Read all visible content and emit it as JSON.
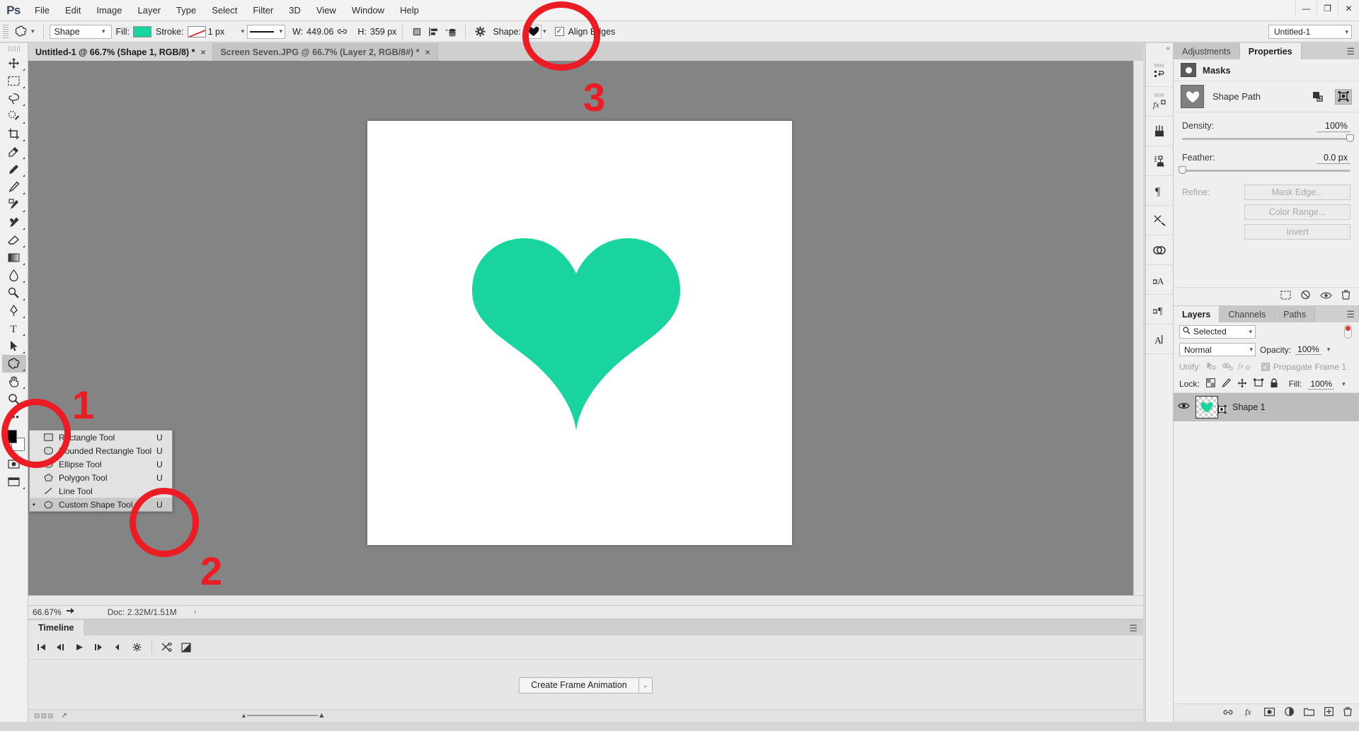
{
  "app": {
    "logo": "Ps",
    "doc_selector": "Untitled-1"
  },
  "menu": {
    "items": [
      "File",
      "Edit",
      "Image",
      "Layer",
      "Type",
      "Select",
      "Filter",
      "3D",
      "View",
      "Window",
      "Help"
    ]
  },
  "window_buttons": {
    "minimize": "—",
    "restore": "❐",
    "close": "✕"
  },
  "options_bar": {
    "tool_icon": "custom-shape-tool-icon",
    "mode": "Shape",
    "fill_label": "Fill:",
    "fill_color": "#1ad4a0",
    "stroke_label": "Stroke:",
    "stroke_width": "1 px",
    "width_label": "W:",
    "width_value": "449.06",
    "link_icon": "link-icon",
    "height_label": "H:",
    "height_value": "359 px",
    "path_op_icon": "path-operations-icon",
    "align_icon": "path-alignment-icon",
    "arrange_icon": "path-arrangement-icon",
    "gear_icon": "gear-icon",
    "shape_label": "Shape:",
    "shape_preview": "heart-shape-icon",
    "align_edges_checked": true,
    "align_edges_label": "Align Edges"
  },
  "tabs": [
    {
      "label": "Untitled-1 @ 66.7% (Shape 1, RGB/8) *",
      "close": "×",
      "active": true
    },
    {
      "label": "Screen Seven.JPG @ 66.7% (Layer 2, RGB/8#) *",
      "close": "×",
      "active": false
    }
  ],
  "toolbar": {
    "tools": [
      {
        "name": "move-tool",
        "glyph": "✥"
      },
      {
        "name": "rectangular-marquee-tool",
        "glyph": "⬚"
      },
      {
        "name": "lasso-tool",
        "glyph": "➰"
      },
      {
        "name": "quick-selection-tool",
        "glyph": "❃"
      },
      {
        "name": "crop-tool",
        "glyph": "⌗"
      },
      {
        "name": "eyedropper-tool",
        "glyph": "✒"
      },
      {
        "name": "spot-healing-brush-tool",
        "glyph": "✑"
      },
      {
        "name": "brush-tool",
        "glyph": "✎"
      },
      {
        "name": "clone-stamp-tool",
        "glyph": "⚑"
      },
      {
        "name": "history-brush-tool",
        "glyph": "✇"
      },
      {
        "name": "eraser-tool",
        "glyph": "▱"
      },
      {
        "name": "gradient-tool",
        "glyph": "◧"
      },
      {
        "name": "blur-tool",
        "glyph": "◌"
      },
      {
        "name": "dodge-tool",
        "glyph": "◕"
      },
      {
        "name": "pen-tool",
        "glyph": "✒"
      },
      {
        "name": "horizontal-type-tool",
        "glyph": "T"
      },
      {
        "name": "path-selection-tool",
        "glyph": "➤"
      },
      {
        "name": "custom-shape-tool",
        "glyph": "❁"
      },
      {
        "name": "hand-tool",
        "glyph": "✋"
      },
      {
        "name": "zoom-tool",
        "glyph": "⌕"
      },
      {
        "name": "more-tools",
        "glyph": "•••"
      }
    ],
    "foreground_color": "#000000",
    "background_color": "#ffffff",
    "quick-mask-name": "quick-mask-mode-icon",
    "screen-mode-name": "screen-mode-icon"
  },
  "flyout_menu": {
    "items": [
      {
        "label": "Rectangle Tool",
        "key": "U",
        "icon": "rectangle-icon",
        "selected": false
      },
      {
        "label": "Rounded Rectangle Tool",
        "key": "U",
        "icon": "rounded-rectangle-icon",
        "selected": false
      },
      {
        "label": "Ellipse Tool",
        "key": "U",
        "icon": "ellipse-icon",
        "selected": false
      },
      {
        "label": "Polygon Tool",
        "key": "U",
        "icon": "polygon-icon",
        "selected": false
      },
      {
        "label": "Line Tool",
        "key": "U",
        "icon": "line-icon",
        "selected": false
      },
      {
        "label": "Custom Shape Tool",
        "key": "U",
        "icon": "custom-shape-icon",
        "selected": true
      }
    ],
    "bullet": "▪"
  },
  "canvas": {
    "artboard_background": "#ffffff",
    "shape_color": "#1ad4a0",
    "shape_name": "heart-shape"
  },
  "status_bar": {
    "zoom": "66.67%",
    "share_icon": "share-icon",
    "doc_info": "Doc: 2.32M/1.51M",
    "expand_arrow": "›"
  },
  "timeline": {
    "tab_label": "Timeline",
    "menu_icon": "panel-menu-icon",
    "buttons": [
      {
        "name": "go-to-first-frame-button",
        "glyph": "⏮"
      },
      {
        "name": "select-previous-frame-button",
        "glyph": "⏪"
      },
      {
        "name": "play-button",
        "glyph": "▶"
      },
      {
        "name": "select-next-frame-button",
        "glyph": "⏩"
      },
      {
        "name": "audio-button",
        "glyph": "◀"
      },
      {
        "name": "settings-gear-button",
        "glyph": "⚙"
      },
      {
        "name": "split-at-playhead-button",
        "glyph": "✂"
      },
      {
        "name": "transition-button",
        "glyph": "◥"
      }
    ],
    "create_label": "Create Frame Animation",
    "create_caret": "⌄"
  },
  "icon_dock": {
    "items": [
      {
        "name": "history-panel-icon",
        "glyph": "↺"
      },
      {
        "name": "styles-panel-icon",
        "glyph": "fx"
      },
      {
        "name": "brush-presets-panel-icon",
        "glyph": "☂"
      },
      {
        "name": "clone-source-panel-icon",
        "glyph": "⚑"
      },
      {
        "name": "paragraph-panel-icon",
        "glyph": "¶"
      },
      {
        "name": "tool-presets-panel-icon",
        "glyph": "✂"
      },
      {
        "name": "creative-cloud-panel-icon",
        "glyph": "⚭"
      },
      {
        "name": "character-styles-panel-icon",
        "glyph": "A"
      },
      {
        "name": "paragraph-styles-panel-icon",
        "glyph": "¶"
      },
      {
        "name": "character-panel-icon",
        "glyph": "A"
      }
    ]
  },
  "properties_panel": {
    "tabs": [
      {
        "label": "Adjustments",
        "active": false
      },
      {
        "label": "Properties",
        "active": true
      }
    ],
    "menu_icon": "panel-menu-icon",
    "masks_title": "Masks",
    "masks_icon": "mask-icon",
    "shape_path_label": "Shape Path",
    "shape_path_thumb": "heart-mask-thumbnail",
    "add_mask_icon": "add-pixel-mask-icon",
    "vector_mask_icon": "vector-mask-icon",
    "density": {
      "label": "Density:",
      "value": "100%",
      "percent": 100
    },
    "feather": {
      "label": "Feather:",
      "value": "0.0 px",
      "percent": 0
    },
    "refine_label": "Refine:",
    "refine_buttons": [
      "Mask Edge...",
      "Color Range...",
      "Invert"
    ],
    "footer_icons": [
      {
        "name": "mask-selection-icon",
        "glyph": "⬚"
      },
      {
        "name": "apply-mask-icon",
        "glyph": "⊘"
      },
      {
        "name": "toggle-mask-visibility-icon",
        "glyph": "◉"
      },
      {
        "name": "delete-mask-icon",
        "glyph": "⌧"
      }
    ]
  },
  "layers_panel": {
    "tabs": [
      {
        "label": "Layers",
        "active": true
      },
      {
        "label": "Channels",
        "active": false
      },
      {
        "label": "Paths",
        "active": false
      }
    ],
    "menu_icon": "panel-menu-icon",
    "filter": {
      "icon": "search-icon",
      "value": "Selected",
      "caret": "⌄"
    },
    "filter_toggle": "filter-toggle-switch",
    "blend_mode": "Normal",
    "opacity_label": "Opacity:",
    "opacity_value": "100%",
    "unify_label": "Unify:",
    "unify_icons": [
      {
        "name": "unify-position-icon",
        "glyph": "⚒"
      },
      {
        "name": "unify-visibility-icon",
        "glyph": "◉"
      },
      {
        "name": "unify-style-icon",
        "glyph": "fx"
      }
    ],
    "propagate_checked": true,
    "propagate_label": "Propagate Frame 1",
    "lock_label": "Lock:",
    "lock_icons": [
      {
        "name": "lock-transparent-pixels-icon",
        "glyph": "⬚"
      },
      {
        "name": "lock-image-pixels-icon",
        "glyph": "✐"
      },
      {
        "name": "lock-position-icon",
        "glyph": "✥"
      },
      {
        "name": "prevent-artboard-nesting-icon",
        "glyph": "⌧"
      },
      {
        "name": "lock-all-icon",
        "glyph": "🔒"
      }
    ],
    "fill_label": "Fill:",
    "fill_value": "100%",
    "layers": [
      {
        "name": "Shape 1",
        "visible": true,
        "selected": true,
        "thumb_color": "#1ad4a0"
      }
    ],
    "footer_icons": [
      {
        "name": "link-layers-icon",
        "glyph": "⚭"
      },
      {
        "name": "add-layer-style-icon",
        "glyph": "fx"
      },
      {
        "name": "add-layer-mask-icon",
        "glyph": "▣"
      },
      {
        "name": "new-adjustment-layer-icon",
        "glyph": "◐"
      },
      {
        "name": "new-group-icon",
        "glyph": "□"
      },
      {
        "name": "new-layer-icon",
        "glyph": "⊞"
      },
      {
        "name": "delete-layer-icon",
        "glyph": "🗑"
      }
    ]
  },
  "annotations": [
    {
      "number": "1",
      "target": "custom-shape-tool-in-toolbar"
    },
    {
      "number": "2",
      "target": "custom-shape-tool-menu-item"
    },
    {
      "number": "3",
      "target": "shape-preview-picker"
    }
  ]
}
